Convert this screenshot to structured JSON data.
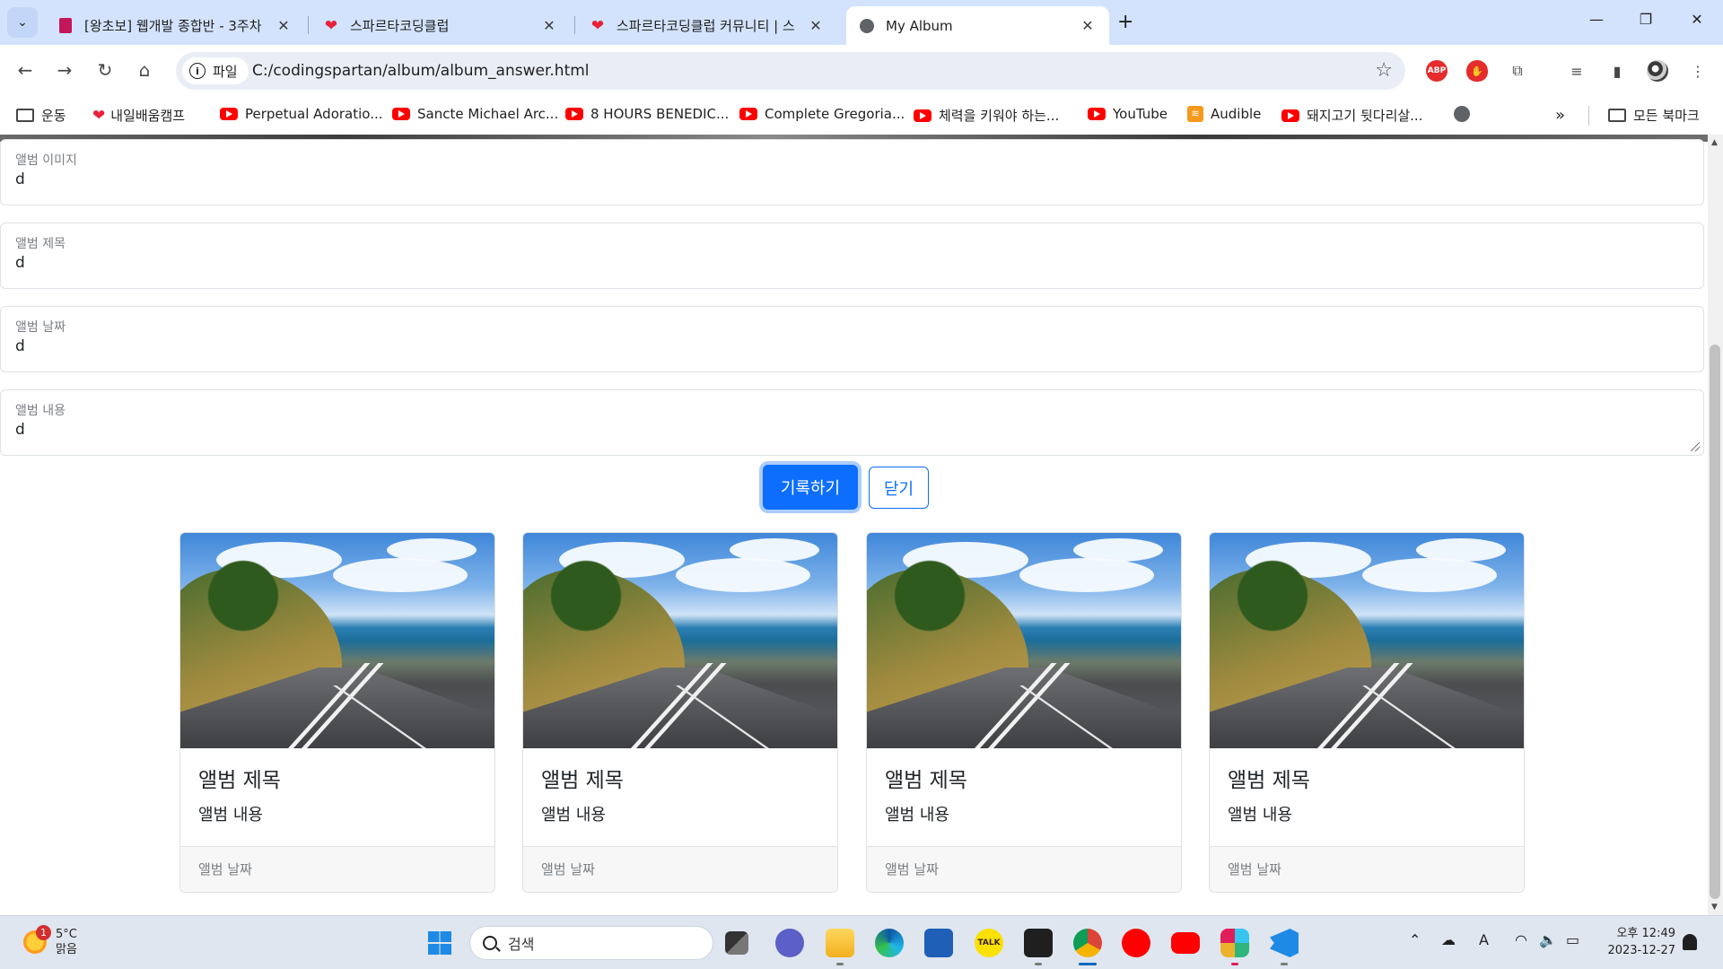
{
  "browser": {
    "tabs": [
      {
        "title": "[왕초보] 웹개발 종합반 - 3주차",
        "favicon": "book-icon",
        "active": false
      },
      {
        "title": "스파르타코딩클럽",
        "favicon": "heart-icon",
        "active": false
      },
      {
        "title": "스파르타코딩클럽 커뮤니티 | 스",
        "favicon": "heart-icon",
        "active": false
      },
      {
        "title": "My Album",
        "favicon": "globe-icon",
        "active": true
      }
    ],
    "address": {
      "chip_label": "파일",
      "url": "C:/codingspartan/album/album_answer.html"
    },
    "extensions": {
      "abp_label": "ABP"
    }
  },
  "bookmarks": [
    {
      "label": "운동",
      "icon": "folder-icon"
    },
    {
      "label": "내일배움캠프",
      "icon": "heart-icon"
    },
    {
      "label": "Perpetual Adoratio...",
      "icon": "youtube-icon"
    },
    {
      "label": "Sancte Michael Arc...",
      "icon": "youtube-icon"
    },
    {
      "label": "8 HOURS BENEDIC...",
      "icon": "youtube-icon"
    },
    {
      "label": "Complete Gregoria...",
      "icon": "youtube-icon"
    },
    {
      "label": "체력을 키워야 하는...",
      "icon": "youtube-icon"
    },
    {
      "label": "YouTube",
      "icon": "youtube-icon"
    },
    {
      "label": "Audible",
      "icon": "audible-icon"
    },
    {
      "label": "돼지고기 뒷다리살...",
      "icon": "youtube-icon"
    }
  ],
  "bookmarks_all": "모든 북마크",
  "form": {
    "image": {
      "label": "앨범 이미지",
      "value": "d"
    },
    "title": {
      "label": "앨범 제목",
      "value": "d"
    },
    "date": {
      "label": "앨범 날짜",
      "value": "d"
    },
    "content": {
      "label": "앨범 내용",
      "value": "d"
    },
    "submit_label": "기록하기",
    "close_label": "닫기"
  },
  "cards": [
    {
      "title": "앨범 제목",
      "text": "앨범 내용",
      "date": "앨범 날짜"
    },
    {
      "title": "앨범 제목",
      "text": "앨범 내용",
      "date": "앨범 날짜"
    },
    {
      "title": "앨범 제목",
      "text": "앨범 내용",
      "date": "앨범 날짜"
    },
    {
      "title": "앨범 제목",
      "text": "앨범 내용",
      "date": "앨범 날짜"
    }
  ],
  "taskbar": {
    "weather": {
      "temp": "5°C",
      "condition": "맑음",
      "badge": "1"
    },
    "search_label": "검색",
    "tray_lang": "A",
    "clock_time": "오후 12:49",
    "clock_date": "2023-12-27"
  },
  "colors": {
    "primary": "#0d6efd",
    "tabstrip": "#d3e3fd"
  }
}
